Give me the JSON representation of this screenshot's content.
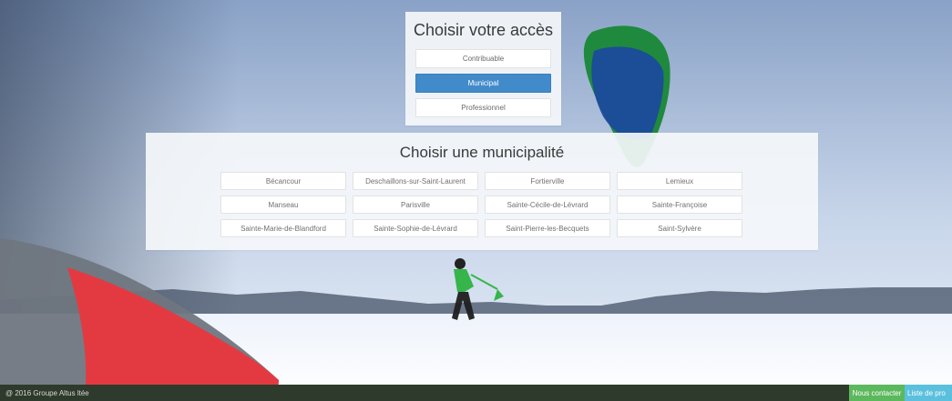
{
  "access_panel": {
    "title": "Choisir votre accès",
    "buttons": [
      {
        "label": "Contribuable",
        "active": false
      },
      {
        "label": "Municipal",
        "active": true
      },
      {
        "label": "Professionnel",
        "active": false
      }
    ]
  },
  "municipality_panel": {
    "title": "Choisir une municipalité",
    "items": [
      "Bécancour",
      "Deschaillons-sur-Saint-Laurent",
      "Fortierville",
      "Lemieux",
      "Manseau",
      "Parisville",
      "Sainte-Cécile-de-Lévrard",
      "Sainte-Françoise",
      "Sainte-Marie-de-Blandford",
      "Sainte-Sophie-de-Lévrard",
      "Saint-Pierre-les-Becquets",
      "Saint-Sylvère"
    ]
  },
  "footer": {
    "copyright": "@ 2016 Groupe Altus ltée",
    "contact_label": "Nous contacter",
    "list_label": "Liste de pro"
  },
  "colors": {
    "active_button": "#428bca",
    "contact_button": "#5cb85c",
    "list_button": "#5bc0de",
    "footer_bg": "#2e3a2b"
  }
}
